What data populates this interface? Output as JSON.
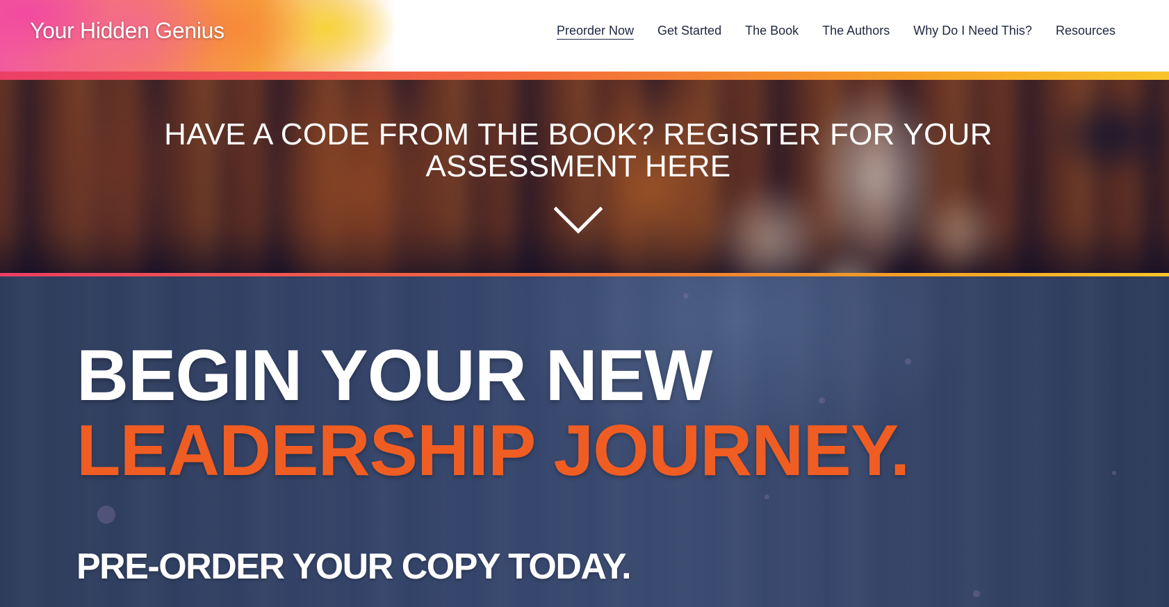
{
  "header": {
    "logo_text": "Your Hidden Genius",
    "nav": [
      {
        "label": "Preorder Now",
        "active": true
      },
      {
        "label": "Get Started"
      },
      {
        "label": "The Book"
      },
      {
        "label": "The Authors"
      },
      {
        "label": "Why Do I Need This?"
      },
      {
        "label": "Resources"
      }
    ]
  },
  "banner": {
    "heading_line1": "HAVE A CODE FROM THE BOOK? REGISTER FOR YOUR",
    "heading_line2": "ASSESSMENT HERE",
    "scroll_icon": "chevron-down-icon"
  },
  "hero": {
    "line1": "BEGIN YOUR NEW",
    "line2": "LEADERSHIP JOURNEY.",
    "subheading": "PRE-ORDER YOUR COPY TODAY."
  },
  "colors": {
    "accent_orange": "#f05d23",
    "hero_bg": "#34446a",
    "nav_text": "#1e2740",
    "gradient_pink": "#ec3f66",
    "gradient_yellow": "#f9c42b"
  }
}
